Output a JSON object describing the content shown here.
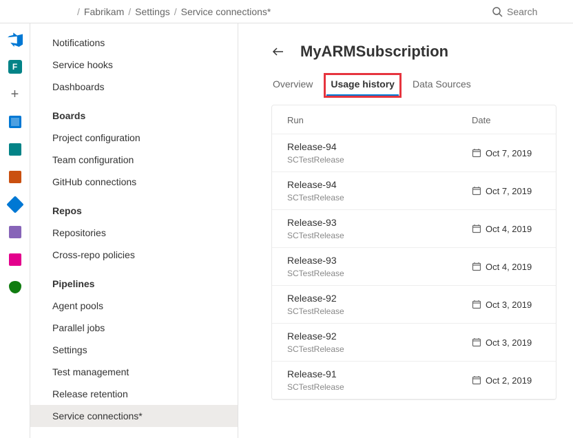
{
  "breadcrumb": {
    "org": "Fabrikam",
    "section": "Settings",
    "page": "Service connections*"
  },
  "search": {
    "placeholder": "Search"
  },
  "rail": {
    "project_initial": "F"
  },
  "sidebar": {
    "top_items": [
      "Notifications",
      "Service hooks",
      "Dashboards"
    ],
    "sections": [
      {
        "title": "Boards",
        "items": [
          "Project configuration",
          "Team configuration",
          "GitHub connections"
        ]
      },
      {
        "title": "Repos",
        "items": [
          "Repositories",
          "Cross-repo policies"
        ]
      },
      {
        "title": "Pipelines",
        "items": [
          "Agent pools",
          "Parallel jobs",
          "Settings",
          "Test management",
          "Release retention",
          "Service connections*"
        ]
      }
    ],
    "selected": "Service connections*"
  },
  "page": {
    "title": "MyARMSubscription",
    "tabs": [
      "Overview",
      "Usage history",
      "Data Sources"
    ],
    "active_tab": "Usage history"
  },
  "table": {
    "headers": {
      "run": "Run",
      "date": "Date"
    },
    "rows": [
      {
        "name": "Release-94",
        "sub": "SCTestRelease",
        "date": "Oct 7, 2019"
      },
      {
        "name": "Release-94",
        "sub": "SCTestRelease",
        "date": "Oct 7, 2019"
      },
      {
        "name": "Release-93",
        "sub": "SCTestRelease",
        "date": "Oct 4, 2019"
      },
      {
        "name": "Release-93",
        "sub": "SCTestRelease",
        "date": "Oct 4, 2019"
      },
      {
        "name": "Release-92",
        "sub": "SCTestRelease",
        "date": "Oct 3, 2019"
      },
      {
        "name": "Release-92",
        "sub": "SCTestRelease",
        "date": "Oct 3, 2019"
      },
      {
        "name": "Release-91",
        "sub": "SCTestRelease",
        "date": "Oct 2, 2019"
      }
    ]
  }
}
